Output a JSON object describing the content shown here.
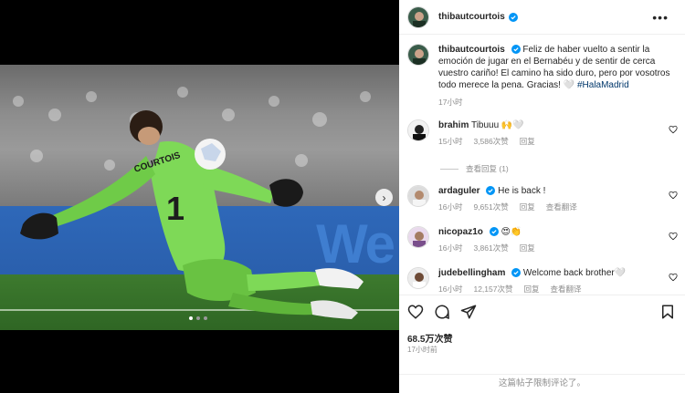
{
  "post": {
    "username": "thibautcourtois",
    "more_label": "•••",
    "photo": {
      "jersey_name": "COURTOIS",
      "jersey_number": "1",
      "board_text": "We",
      "carousel_count": 3,
      "carousel_active": 0
    }
  },
  "caption": {
    "username": "thibautcourtois",
    "text": "Feliz de haber vuelto a sentir la emoción de jugar en el Bernabéu y de sentir de cerca vuestro cariño! El camino ha sido duro, pero por vosotros todo merece la pena. Gracias! 🤍 ",
    "hashtag": "#HalaMadrid",
    "time": "17小时"
  },
  "comments": [
    {
      "username": "brahim",
      "verified": false,
      "text": "Tibuuu 🙌🤍",
      "time": "15小时",
      "likes": "3,586次赞",
      "reply": "回复",
      "replies_label": "查看回复 (1)"
    },
    {
      "username": "ardaguler",
      "verified": true,
      "text": "He is back !",
      "time": "16小时",
      "likes": "9,651次赞",
      "reply": "回复",
      "translate": "查看翻译"
    },
    {
      "username": "nicopaz1o",
      "verified": true,
      "text": "😍👏",
      "time": "16小时",
      "likes": "3,861次赞",
      "reply": "回复"
    },
    {
      "username": "judebellingham",
      "verified": true,
      "text": "Welcome back brother🤍",
      "time": "16小时",
      "likes": "12,157次赞",
      "reply": "回复",
      "translate": "查看翻译"
    }
  ],
  "actions": {
    "likes": "68.5万次赞",
    "time": "17小时前",
    "comments_limited": "这篇帖子限制评论了。"
  },
  "colors": {
    "verified": "#0095f6",
    "jersey": "#7ed957",
    "link": "#00376b",
    "muted": "#8e8e8e"
  }
}
